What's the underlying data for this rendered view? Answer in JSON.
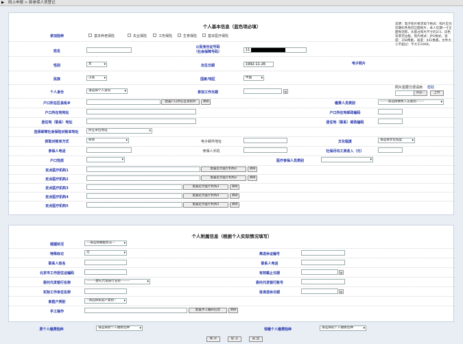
{
  "breadcrumb": {
    "root": "网上申报",
    "current": "新参保人员登记"
  },
  "basic": {
    "title": "个人基本信息（蓝色项必填）",
    "labels": {
      "insurance_type": "参加险种",
      "name": "姓名",
      "id_number": "公民身份证号码",
      "id_number_sub": "（社会保障号码）",
      "gender": "性别",
      "birth_date": "出生日期",
      "ethnicity": "民族",
      "nationality": "国家/地区",
      "identity": "个人身份",
      "work_start": "参加工作日期",
      "hukou": "户口所在区县街乡",
      "hukou_addr": "户口所在地地址",
      "residence": "居住地（联系）地址",
      "mail_addr": "选择邮寄社会保险对账单地址",
      "contact_method": "获取对账单方式",
      "email": "电子邮件地址",
      "education": "文化程度",
      "contact_phone": "参保人电话",
      "mobile": "参保人手机",
      "monthly_wage": "社保月均工资收入（元）",
      "hukou_type": "户口性质",
      "medical_category": "医疗参保人员类别",
      "hospital1": "定点医疗机构1",
      "hospital2": "定点医疗机构2",
      "hospital3": "定点医疗机构3",
      "hospital4": "定点医疗机构4",
      "hospital5": "定点医疗机构5",
      "photo": "电子照片",
      "worker_category": "缴费人员类别",
      "hukou_zip": "户口所在地邮政编码",
      "residence_zip": "居住地（联系）邮政编码"
    },
    "insurance_options": [
      "基本养老保险",
      "失业保险",
      "工伤保险",
      "生育保险",
      "基本医疗保险"
    ],
    "values": {
      "id_number": "11",
      "gender": "女",
      "birth_date": "1992-11-26",
      "ethnicity": "汉族",
      "nationality": "中国",
      "identity": "请选择个人身份",
      "mail_addr": "所在单位地址",
      "contact_method": "邮寄",
      "education": "请选择文化程度",
      "worker_category": "-------请选择缴费人员类别-------"
    },
    "buttons": {
      "hukou_pick": "配置户口所在区县街乡",
      "clear": "清除",
      "h1": "配置定点医疗机构1",
      "h2": "配置定点医疗机构2",
      "h3": "配置定点医疗机构3",
      "h4": "配置定点医疗机构4",
      "h5": "配置定点医疗机构5",
      "photo_browse": "浏览...",
      "photo_upload": "上传"
    },
    "photo_desc": "说明：电子照片要求如下格式：照片应为近期彩色免冠正面照片，本人近期一寸正面免冠照，头部占照片尺寸的2/3，白色背景无边框，照片格式：JPG格式，宽度：358像素，高度：441像素，文件大小不超过：不大于20KB。",
    "photo_note": "照片需要方便请用",
    "photo_link": "帮助"
  },
  "extra": {
    "title": "个人附属信息（根据个人实际情况填写）",
    "labels": {
      "marital": "婚姻状况",
      "special_mark": "特殊标记",
      "contact_name": "联系人姓名",
      "contact_phone": "联系人电话",
      "retire_cert": "离退休证编号",
      "work_permit": "北京市工作居住证编码",
      "valid_until": "有效截止日期",
      "bank_name": "委托代发银行名称",
      "bank_account": "委托代发银行账号",
      "employer": "实际工作单位名称",
      "approval_date": "批准退休日期",
      "household_type": "家庭户类别",
      "handicap": "手工操作",
      "prev_personal": "原个人缴费险种",
      "current_personal": "现缴个人缴费险种"
    },
    "values": {
      "marital": "---请选择婚姻状况---",
      "special_mark": "无",
      "bank_name": "--------委托代发银行名称--------",
      "household_type": "--请选择家庭户类别--",
      "prev_personal": "请选择原个人缴费险种",
      "current_personal": "请选择现个人缴费险种"
    },
    "buttons": {
      "handicap_pick": "配置手工编码信息",
      "clear": "清除"
    }
  },
  "footer": {
    "save": "保 存",
    "submit": "提 交",
    "back": "返 回"
  }
}
